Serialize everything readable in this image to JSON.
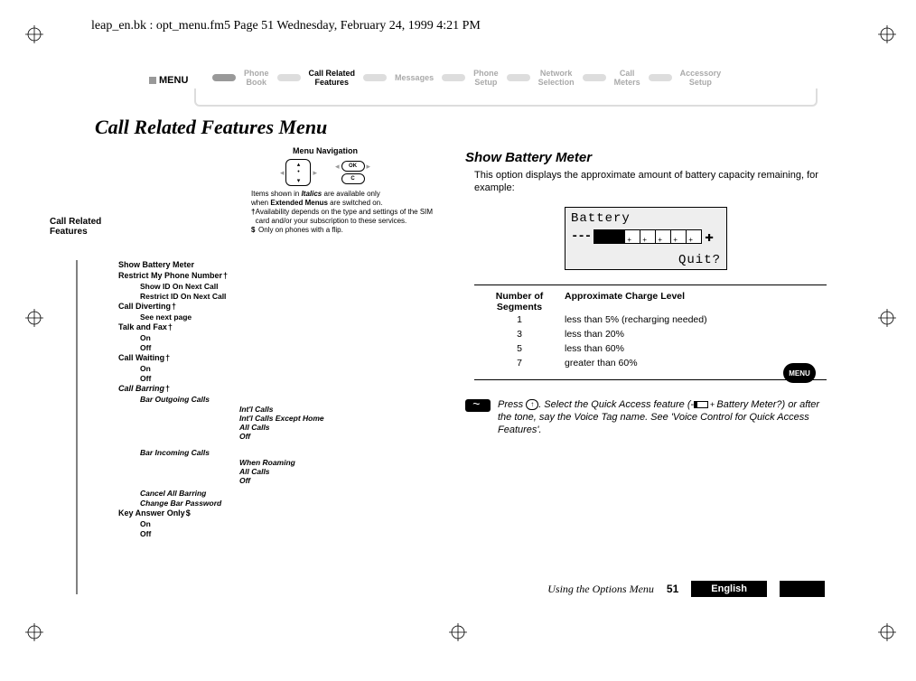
{
  "header_line": "leap_en.bk : opt_menu.fm5  Page 51  Wednesday, February 24, 1999  4:21 PM",
  "menu_bar": {
    "label": "MENU",
    "items": [
      "Phone\nBook",
      "Call Related\nFeatures",
      "Messages",
      "Phone\nSetup",
      "Network\nSelection",
      "Call\nMeters",
      "Accessory\nSetup"
    ],
    "active_index": 1
  },
  "main_title": "Call Related Features Menu",
  "diagram": {
    "menu_navigation_label": "Menu Navigation",
    "ok": "OK",
    "c": "C",
    "notes_intro_1": "Items shown in ",
    "notes_intro_bold": "Italics",
    "notes_intro_2": " are available only",
    "notes_intro_3": "when ",
    "notes_intro_bold2": "Extended Menus",
    "notes_intro_4": " are switched on.",
    "note_dagger": "Availability depends on the type and settings of the SIM card and/or your subscription to these services.",
    "note_dollar": "Only on phones with a flip.",
    "crf_label": "Call Related Features",
    "rows": [
      {
        "label": "Show Battery Meter"
      },
      {
        "label": "Restrict My Phone Number",
        "sup": "†",
        "sub": [
          "Show ID On Next Call",
          "Restrict ID On Next Call"
        ]
      },
      {
        "label": "Call Diverting",
        "sup": "†",
        "sub_text": "See next page"
      },
      {
        "label": "Talk and Fax",
        "sup": "†",
        "sub": [
          "On",
          "Off"
        ]
      },
      {
        "label": "Call Waiting",
        "sup": "†",
        "sub": [
          "On",
          "Off"
        ]
      },
      {
        "label": "Call Barring",
        "sup": "†",
        "ital": true
      },
      {
        "label": "Key Answer Only",
        "sup": "$",
        "sub": [
          "On",
          "Off"
        ]
      }
    ],
    "barring_sub": {
      "outgoing": {
        "label": "Bar Outgoing Calls",
        "sub": [
          "Int'l Calls",
          "Int'l Calls Except Home",
          "All Calls",
          "Off"
        ]
      },
      "incoming": {
        "label": "Bar Incoming Calls",
        "sub": [
          "When Roaming",
          "All Calls",
          "Off"
        ]
      },
      "cancel": "Cancel All Barring",
      "change": "Change Bar Password"
    }
  },
  "battery_section": {
    "title": "Show Battery Meter",
    "body": "This option displays the approximate amount of battery capacity remaining, for example:",
    "box": {
      "line1": "Battery",
      "quit": "Quit?"
    },
    "table": {
      "col1": "Number of Segments",
      "col2": "Approximate Charge Level",
      "rows": [
        {
          "n": "1",
          "v": "less than 5% (recharging needed)"
        },
        {
          "n": "3",
          "v": "less than 20%"
        },
        {
          "n": "5",
          "v": "less than 60%"
        },
        {
          "n": "7",
          "v": "greater than 60%"
        }
      ]
    },
    "tip_1": "Press ",
    "tip_key": "↑",
    "tip_2": ". Select the Quick Access feature (",
    "tip_3": " Battery Meter?) or after the tone, say the Voice Tag name. See 'Voice Control for Quick Access Features'."
  },
  "menu_chip": "MENU",
  "footer": {
    "section": "Using the Options Menu",
    "page": "51",
    "lang": "English"
  }
}
